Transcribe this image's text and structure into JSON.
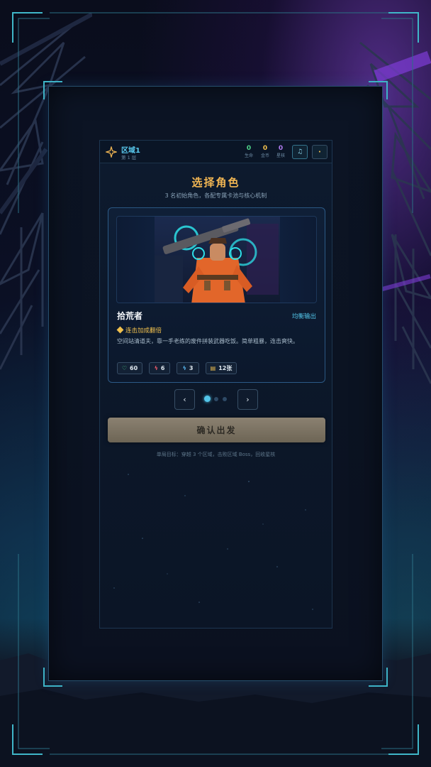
{
  "header": {
    "zone_name": "区域1",
    "zone_floor": "第 1 层",
    "stats": [
      {
        "value": "0",
        "label": "生命",
        "color": "#4fd58a"
      },
      {
        "value": "0",
        "label": "金币",
        "color": "#f0c04e"
      },
      {
        "value": "0",
        "label": "星核",
        "color": "#b07cf0"
      }
    ],
    "music_icon": "music-note-icon",
    "settings_icon": "dot-icon"
  },
  "screen": {
    "title": "选择角色",
    "subtitle": "3 名初始角色，各配专属卡池与核心机制"
  },
  "character": {
    "name": "拾荒者",
    "role": "均衡输出",
    "trait": "连击加成翻倍",
    "description": "空间站清道夫，靠一手老练的废件拼装武器吃饭。简单粗暴，连击爽快。",
    "stats": [
      {
        "icon": "heart-icon",
        "glyph": "♡",
        "value": "60",
        "color": "#4fd58a"
      },
      {
        "icon": "power-icon",
        "glyph": "ϟ",
        "value": "6",
        "color": "#ef5b6b"
      },
      {
        "icon": "energy-icon",
        "glyph": "ϟ",
        "value": "3",
        "color": "#58b7f0"
      },
      {
        "icon": "card-deck-icon",
        "glyph": "▤",
        "value": "12张",
        "color": "#f0c04e"
      }
    ]
  },
  "carousel": {
    "prev": "‹",
    "next": "›",
    "total": 3,
    "active": 1
  },
  "actions": {
    "confirm_label": "确认出发"
  },
  "footer": {
    "goal_text": "单局目标：穿越 3 个区域，击败区域 Boss，回收星核"
  },
  "colors": {
    "accent_cyan": "#53c6ea",
    "accent_gold": "#f1b653",
    "frame_teal": "#3fb6c8"
  }
}
